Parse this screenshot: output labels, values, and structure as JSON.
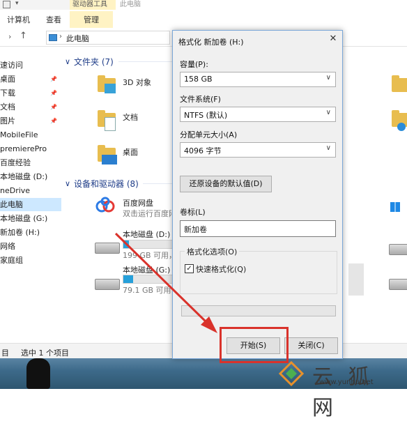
{
  "ribbon": {
    "context_tab": "驱动器工具",
    "window_title": "此电脑",
    "tabs": [
      "计算机",
      "查看",
      "管理"
    ]
  },
  "address": {
    "path": "此电脑",
    "nav_icons": [
      "chevron-right-icon",
      "up-arrow-icon",
      "computer-icon"
    ]
  },
  "sidebar": {
    "items": [
      {
        "label": "速访问",
        "pinned": false,
        "active": false
      },
      {
        "label": "桌面",
        "pinned": true,
        "active": false
      },
      {
        "label": "下载",
        "pinned": true,
        "active": false
      },
      {
        "label": "文档",
        "pinned": true,
        "active": false
      },
      {
        "label": "图片",
        "pinned": true,
        "active": false
      },
      {
        "label": "MobileFile",
        "pinned": false,
        "active": false
      },
      {
        "label": "premierePro",
        "pinned": false,
        "active": false
      },
      {
        "label": "百度经验",
        "pinned": false,
        "active": false
      },
      {
        "label": "本地磁盘 (D:)",
        "pinned": false,
        "active": false
      },
      {
        "label": "neDrive",
        "pinned": false,
        "active": false
      },
      {
        "label": "此电脑",
        "pinned": false,
        "active": true
      },
      {
        "label": "本地磁盘 (G:)",
        "pinned": false,
        "active": false
      },
      {
        "label": "新加卷 (H:)",
        "pinned": false,
        "active": false
      },
      {
        "label": "网络",
        "pinned": false,
        "active": false
      },
      {
        "label": "家庭组",
        "pinned": false,
        "active": false
      }
    ]
  },
  "content": {
    "folders_header": "文件夹 (7)",
    "folders": [
      "3D 对象",
      "文档",
      "桌面"
    ],
    "devices_header": "设备和驱动器 (8)",
    "devices": [
      {
        "name": "百度网盘",
        "sub": "双击运行百度网"
      },
      {
        "name": "本地磁盘 (D:)",
        "sub": "199 GB 可用，",
        "used_fraction": 0.12
      },
      {
        "name": "本地磁盘 (G:)",
        "sub": "79.1 GB 可用",
        "used_fraction": 0.2
      }
    ]
  },
  "status": {
    "count": "目",
    "selected": "选中 1 个项目"
  },
  "dialog": {
    "title": "格式化 新加卷 (H:)",
    "capacity_label": "容量(P):",
    "capacity_value": "158 GB",
    "fs_label": "文件系统(F)",
    "fs_value": "NTFS (默认)",
    "unit_label": "分配单元大小(A)",
    "unit_value": "4096 字节",
    "restore_button": "还原设备的默认值(D)",
    "volume_label": "卷标(L)",
    "volume_value": "新加卷",
    "options_legend": "格式化选项(O)",
    "quick_format": "快速格式化(Q)",
    "quick_format_checked": true,
    "start_button": "开始(S)",
    "close_button": "关闭(C)"
  },
  "watermark": {
    "brand": "云 狐 网",
    "url": "www.yunhu.net"
  },
  "colors": {
    "accent": "#26a0da",
    "annotation_red": "#d9322b",
    "context_tab": "#fff3c4"
  }
}
